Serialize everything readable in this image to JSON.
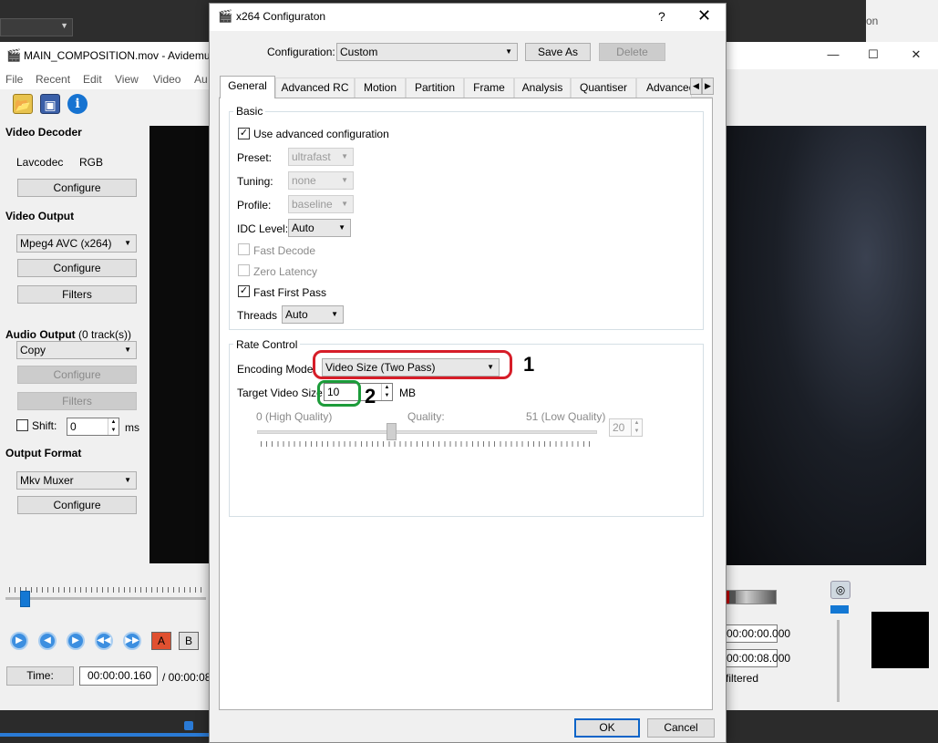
{
  "background_app": {
    "window_title": "MAIN_COMPOSITION.mov - Avidemu",
    "right_fragment": "on",
    "menu": [
      "File",
      "Recent",
      "Edit",
      "View",
      "Video",
      "Au"
    ],
    "video_decoder": {
      "title": "Video Decoder",
      "codec": "Lavcodec",
      "format": "RGB",
      "configure": "Configure"
    },
    "video_output": {
      "title": "Video Output",
      "codec": "Mpeg4 AVC (x264)",
      "configure": "Configure",
      "filters": "Filters"
    },
    "audio_output": {
      "title": "Audio Output",
      "tracks": "(0 track(s))",
      "codec": "Copy",
      "configure": "Configure",
      "filters": "Filters",
      "shift_label": "Shift:",
      "shift_value": "0",
      "shift_unit": "ms"
    },
    "output_format": {
      "title": "Output Format",
      "muxer": "Mkv Muxer",
      "configure": "Configure"
    },
    "ab_buttons": [
      "A",
      "B"
    ],
    "time_label": "Time:",
    "time_value": "00:00:00.160",
    "duration": "/ 00:00:08",
    "selection_a": "00:00:00.000",
    "selection_b": "00:00:08.000",
    "filtered_label": "filtered",
    "colors": {
      "accent": "#1478d4"
    }
  },
  "dialog": {
    "title": "x264 Configuraton",
    "help": "?",
    "close": "✕",
    "configuration_label": "Configuration:",
    "configuration_value": "Custom",
    "save_as": "Save As",
    "delete": "Delete",
    "tabs": [
      "General",
      "Advanced RC",
      "Motion",
      "Partition",
      "Frame",
      "Analysis",
      "Quantiser",
      "Advanced"
    ],
    "active_tab": "General",
    "basic": {
      "title": "Basic",
      "use_advanced": "Use advanced configuration",
      "use_advanced_checked": true,
      "preset_label": "Preset:",
      "preset_value": "ultrafast",
      "tuning_label": "Tuning:",
      "tuning_value": "none",
      "profile_label": "Profile:",
      "profile_value": "baseline",
      "idc_label": "IDC Level:",
      "idc_value": "Auto",
      "fast_decode": "Fast Decode",
      "zero_latency": "Zero Latency",
      "fast_first_pass": "Fast First Pass",
      "fast_first_pass_checked": true,
      "threads_label": "Threads",
      "threads_value": "Auto"
    },
    "rate_control": {
      "title": "Rate Control",
      "encoding_mode_label": "Encoding Mode:",
      "encoding_mode_value": "Video Size (Two Pass)",
      "target_size_label": "Target Video Size:",
      "target_size_value": "10",
      "target_size_unit": "MB",
      "quality_high": "0 (High Quality)",
      "quality_label": "Quality:",
      "quality_low": "51 (Low Quality)",
      "quality_value": "20",
      "quality_slider_position": 0.39
    },
    "annotations": {
      "one": "1",
      "two": "2",
      "colors": {
        "box1": "#d61d28",
        "box2": "#1c9b3a"
      }
    },
    "ok": "OK",
    "cancel": "Cancel"
  }
}
